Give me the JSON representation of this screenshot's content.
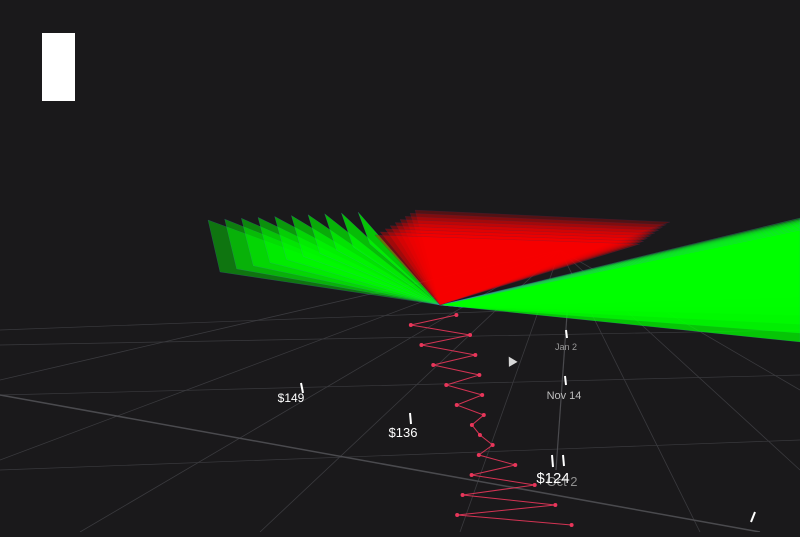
{
  "chart_data": {
    "type": "line",
    "view": "3d-perspective",
    "x_axis": {
      "type": "date",
      "tick_labels": [
        "Jan 2",
        "Nov 14",
        "Oct 2"
      ]
    },
    "price_axis": {
      "tick_labels": [
        "$149",
        "$136",
        "$124"
      ]
    },
    "series": [
      {
        "style": "line-markers",
        "color": "#e8365a",
        "values": [
          146,
          144,
          147,
          142,
          145,
          140,
          143,
          138,
          141,
          137,
          139,
          135,
          136,
          132,
          134,
          129,
          131,
          127,
          128,
          125,
          126,
          124
        ]
      }
    ],
    "surface_colors": {
      "bid": "#00ff00",
      "ask": "#ff0000",
      "edge": "#5a66ff"
    },
    "grid": true,
    "legend": "none"
  },
  "colors": {
    "background": "#1a191b",
    "grid": "#3a3a3e",
    "panel": "#ffffff"
  }
}
